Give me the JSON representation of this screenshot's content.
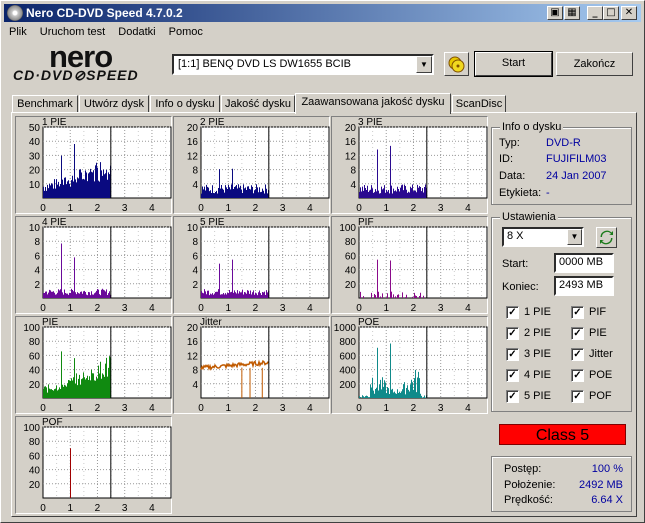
{
  "window": {
    "title": "Nero CD-DVD Speed 4.7.0.2",
    "min": "_",
    "max": "□",
    "close": "✕",
    "extra1": "▣",
    "extra2": "▦"
  },
  "menu": [
    "Plik",
    "Uruchom test",
    "Dodatki",
    "Pomoc"
  ],
  "logo": {
    "top": "nero",
    "bottom": "CD·DVD⊘SPEED"
  },
  "drive": {
    "selected": "[1:1]   BENQ DVD LS DW1655 BCIB"
  },
  "buttons": {
    "start": "Start",
    "end": "Zakończ"
  },
  "tabs": [
    "Benchmark",
    "Utwórz dysk",
    "Info o dysku",
    "Jakość dysku",
    "Zaawansowana jakość dysku",
    "ScanDisc"
  ],
  "active_tab": 4,
  "disc_info": {
    "title": "Info o dysku",
    "type_label": "Typ:",
    "type_value": "DVD-R",
    "id_label": "ID:",
    "id_value": "FUJIFILM03",
    "date_label": "Data:",
    "date_value": "24 Jan 2007",
    "tag_label": "Etykieta:",
    "tag_value": "-"
  },
  "settings": {
    "title": "Ustawienia",
    "speed": "8 X",
    "start_label": "Start:",
    "start_value": "0000 MB",
    "end_label": "Koniec:",
    "end_value": "2493 MB",
    "checks_left": [
      {
        "label": "1 PIE",
        "checked": true
      },
      {
        "label": "2 PIE",
        "checked": true
      },
      {
        "label": "3 PIE",
        "checked": true
      },
      {
        "label": "4 PIE",
        "checked": true
      },
      {
        "label": "5 PIE",
        "checked": true
      }
    ],
    "checks_right": [
      {
        "label": "PIF",
        "checked": true
      },
      {
        "label": "PIE",
        "checked": true
      },
      {
        "label": "Jitter",
        "checked": true
      },
      {
        "label": "POE",
        "checked": true
      },
      {
        "label": "POF",
        "checked": true
      }
    ]
  },
  "class_label": "Class 5",
  "status": {
    "progress_label": "Postęp:",
    "progress_value": "100 %",
    "position_label": "Położenie:",
    "position_value": "2492 MB",
    "speed_label": "Prędkość:",
    "speed_value": "6.64 X"
  },
  "colors": {
    "navy": "#0a0a80",
    "purple": "#6a0a9a",
    "green": "#108a10",
    "orange": "#c05a00",
    "teal": "#108a8a",
    "red": "#a00000"
  },
  "chart_data": [
    {
      "type": "bar",
      "title": "1 PIE",
      "ylim": [
        0,
        50
      ],
      "yticks": [
        10,
        20,
        30,
        40,
        50
      ],
      "xticks": [
        0,
        1,
        2,
        3,
        4
      ],
      "xlim": [
        0,
        4.7
      ],
      "data_end": 2.49,
      "color": "#0a0a80",
      "profile": "rising",
      "base": 8,
      "peak": 40
    },
    {
      "type": "bar",
      "title": "2 PIE",
      "ylim": [
        0,
        20
      ],
      "yticks": [
        4,
        8,
        12,
        16,
        20
      ],
      "xticks": [
        0,
        1,
        2,
        3,
        4
      ],
      "xlim": [
        0,
        4.7
      ],
      "data_end": 2.49,
      "color": "#0a0a80",
      "profile": "flat",
      "base": 3,
      "peak": 10
    },
    {
      "type": "bar",
      "title": "3 PIE",
      "ylim": [
        0,
        20
      ],
      "yticks": [
        4,
        8,
        12,
        16,
        20
      ],
      "xticks": [
        0,
        1,
        2,
        3,
        4
      ],
      "xlim": [
        0,
        4.7
      ],
      "data_end": 2.49,
      "color": "#2a0a90",
      "profile": "flat",
      "base": 3,
      "peak": 16
    },
    {
      "type": "bar",
      "title": "4 PIE",
      "ylim": [
        0,
        10
      ],
      "yticks": [
        2,
        4,
        6,
        8,
        10
      ],
      "xticks": [
        0,
        1,
        2,
        3,
        4
      ],
      "xlim": [
        0,
        4.7
      ],
      "data_end": 2.49,
      "color": "#6a0a9a",
      "profile": "flat",
      "base": 1,
      "peak": 8
    },
    {
      "type": "bar",
      "title": "5 PIE",
      "ylim": [
        0,
        10
      ],
      "yticks": [
        2,
        4,
        6,
        8,
        10
      ],
      "xticks": [
        0,
        1,
        2,
        3,
        4
      ],
      "xlim": [
        0,
        4.7
      ],
      "data_end": 2.49,
      "color": "#6a0a9a",
      "profile": "flat",
      "base": 1,
      "peak": 6
    },
    {
      "type": "bar",
      "title": "PIF",
      "ylim": [
        0,
        100
      ],
      "yticks": [
        20,
        40,
        60,
        80,
        100
      ],
      "xticks": [
        0,
        1,
        2,
        3,
        4
      ],
      "xlim": [
        0,
        4.7
      ],
      "data_end": 2.49,
      "color": "#8a0a8a",
      "profile": "sparse",
      "base": 3,
      "peak": 70
    },
    {
      "type": "bar",
      "title": "PIE",
      "ylim": [
        0,
        100
      ],
      "yticks": [
        20,
        40,
        60,
        80,
        100
      ],
      "xticks": [
        0,
        1,
        2,
        3,
        4
      ],
      "xlim": [
        0,
        4.7
      ],
      "data_end": 2.49,
      "color": "#108a10",
      "profile": "rising",
      "base": 12,
      "peak": 80
    },
    {
      "type": "line",
      "title": "Jitter",
      "ylim": [
        0,
        20
      ],
      "yticks": [
        4,
        8,
        12,
        16,
        20
      ],
      "xticks": [
        0,
        1,
        2,
        3,
        4
      ],
      "xlim": [
        0,
        4.7
      ],
      "data_end": 2.49,
      "color": "#c05a00",
      "profile": "jitter",
      "base": 8.5,
      "peak": 10
    },
    {
      "type": "bar",
      "title": "POE",
      "ylim": [
        0,
        1000
      ],
      "yticks": [
        200,
        400,
        600,
        800,
        1000
      ],
      "xticks": [
        0,
        1,
        2,
        3,
        4
      ],
      "xlim": [
        0,
        4.7
      ],
      "data_end": 2.49,
      "color": "#108a8a",
      "profile": "poe",
      "base": 50,
      "peak": 850
    },
    {
      "type": "bar",
      "title": "POF",
      "ylim": [
        0,
        100
      ],
      "yticks": [
        20,
        40,
        60,
        80,
        100
      ],
      "xticks": [
        0,
        1,
        2,
        3,
        4
      ],
      "xlim": [
        0,
        4.7
      ],
      "data_end": 2.49,
      "color": "#a00000",
      "profile": "single",
      "base": 0,
      "peak": 70
    }
  ]
}
